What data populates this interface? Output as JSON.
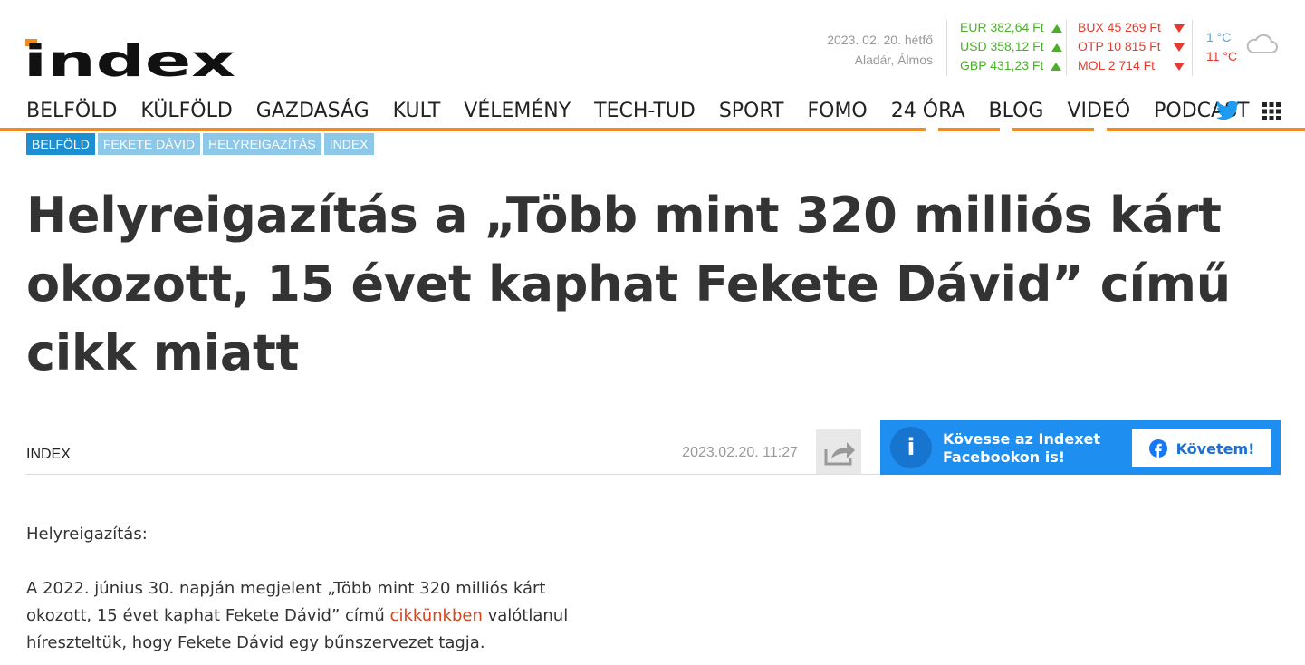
{
  "header": {
    "logo_text": "index",
    "date": "2023. 02. 20. hétfő",
    "namedays": "Aladár, Álmos",
    "currencies": [
      {
        "label": "EUR 382,64 Ft",
        "trend": "up"
      },
      {
        "label": "USD 358,12 Ft",
        "trend": "up"
      },
      {
        "label": "GBP 431,23 Ft",
        "trend": "up"
      }
    ],
    "stocks": [
      {
        "label": "BUX 45 269 Ft",
        "trend": "down"
      },
      {
        "label": "OTP 10 815 Ft",
        "trend": "down"
      },
      {
        "label": "MOL 2 714 Ft",
        "trend": "down"
      }
    ],
    "weather": {
      "low": "1 °C",
      "high": "11 °C",
      "icon": "cloud-icon"
    }
  },
  "nav": {
    "items": [
      "BELFÖLD",
      "KÜLFÖLD",
      "GAZDASÁG",
      "KULT",
      "VÉLEMÉNY",
      "TECH-TUD",
      "SPORT",
      "FOMO",
      "24 ÓRA",
      "BLOG",
      "VIDEÓ",
      "PODCAST"
    ],
    "twitter_icon": "twitter-icon",
    "menu_icon": "grid-menu-icon",
    "accent_color": "#f28a1e"
  },
  "tags": [
    "BELFÖLD",
    "FEKETE DÁVID",
    "HELYREIGAZÍTÁS",
    "INDEX"
  ],
  "article": {
    "title": "Helyreigazítás a „Több mint 320 milliós kárt okozott, 15 évet kaphat Fekete Dávid” című cikk miatt",
    "author": "INDEX",
    "published": "2023.02.20. 11:27",
    "share_icon": "share-icon",
    "paragraph1": "Helyreigazítás:",
    "paragraph2_before": "A 2022. június 30. napján megjelent „Több mint 320 milliós kárt okozott, 15 évet kaphat Fekete Dávid” című ",
    "paragraph2_link": "cikkünkben",
    "paragraph2_after": " valótlanul híreszteltük, hogy Fekete Dávid egy bűnszervezet tagja."
  },
  "facebook_box": {
    "text": "Kövesse az Indexet Facebookon is!",
    "button_label": "Követem!",
    "badge": "i",
    "color": "#1f8ef1"
  }
}
